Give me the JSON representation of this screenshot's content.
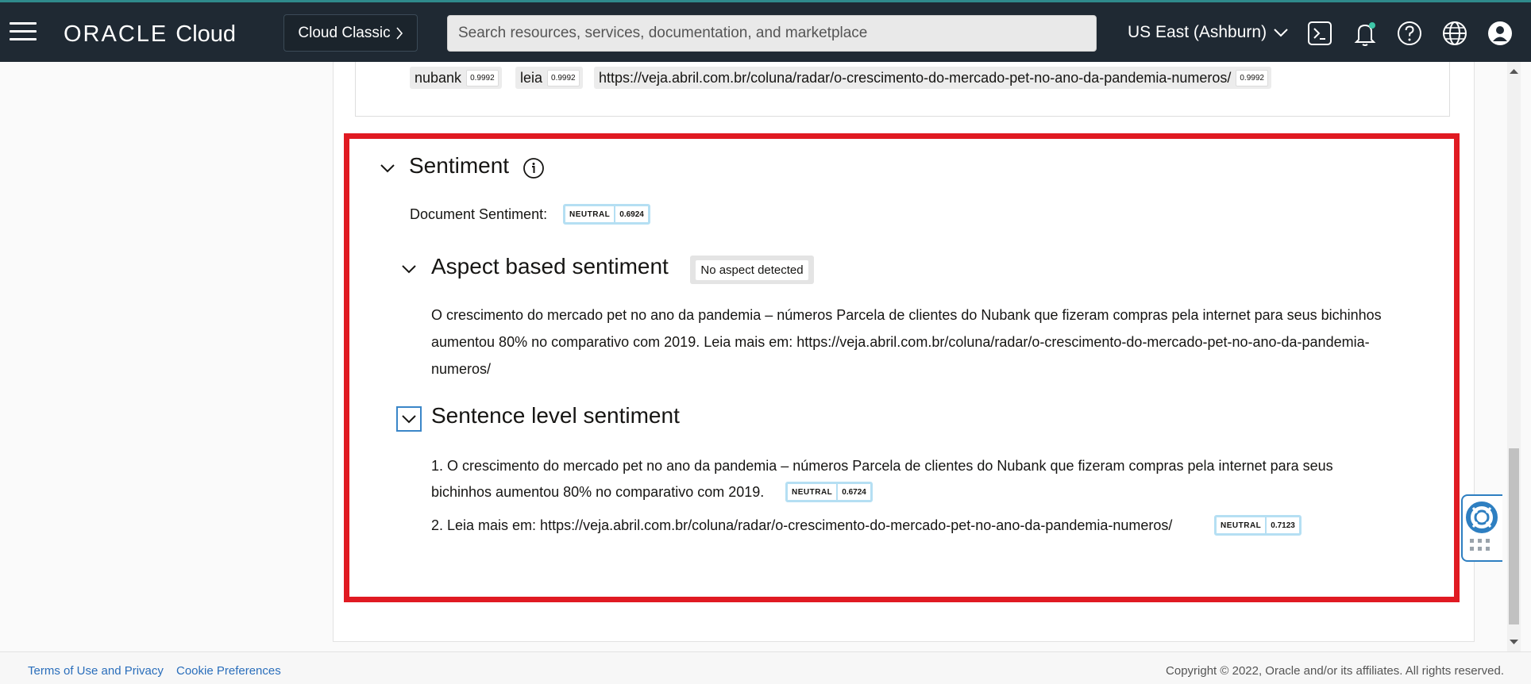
{
  "header": {
    "brand": "ORACLE",
    "product": "Cloud",
    "classic_button": "Cloud Classic",
    "search_placeholder": "Search resources, services, documentation, and marketplace",
    "region": "US East (Ashburn)"
  },
  "key_phrases": [
    {
      "text": "nubank",
      "score": "0.9992"
    },
    {
      "text": "leia",
      "score": "0.9992"
    },
    {
      "text": "https://veja.abril.com.br/coluna/radar/o-crescimento-do-mercado-pet-no-ano-da-pandemia-numeros/",
      "score": "0.9992"
    }
  ],
  "sentiment": {
    "title": "Sentiment",
    "document_label": "Document Sentiment:",
    "document_value": "NEUTRAL",
    "document_score": "0.6924",
    "aspect_title": "Aspect based sentiment",
    "aspect_chip": "No aspect detected",
    "aspect_text": "O crescimento do mercado pet no ano da pandemia – números Parcela de clientes do Nubank que fizeram compras pela internet para seus bichinhos aumentou 80% no comparativo com 2019. Leia mais em: https://veja.abril.com.br/coluna/radar/o-crescimento-do-mercado-pet-no-ano-da-pandemia-numeros/",
    "sentence_title": "Sentence level sentiment",
    "sentences": [
      {
        "line1": "1. O crescimento do mercado pet no ano da pandemia – números Parcela de clientes do Nubank que fizeram compras pela internet para seus",
        "line2": "bichinhos aumentou 80% no comparativo com 2019.",
        "value": "NEUTRAL",
        "score": "0.6724"
      },
      {
        "line1": "2. Leia mais em: https://veja.abril.com.br/coluna/radar/o-crescimento-do-mercado-pet-no-ano-da-pandemia-numeros/",
        "value": "NEUTRAL",
        "score": "0.7123"
      }
    ]
  },
  "footer": {
    "terms": "Terms of Use and Privacy",
    "cookies": "Cookie Preferences",
    "copyright": "Copyright © 2022, Oracle and/or its affiliates. All rights reserved."
  },
  "colors": {
    "topbar": "#1f2933",
    "highlight_frame": "#e01a22",
    "badge_border": "#b5dff3",
    "link": "#2a6ebb"
  }
}
